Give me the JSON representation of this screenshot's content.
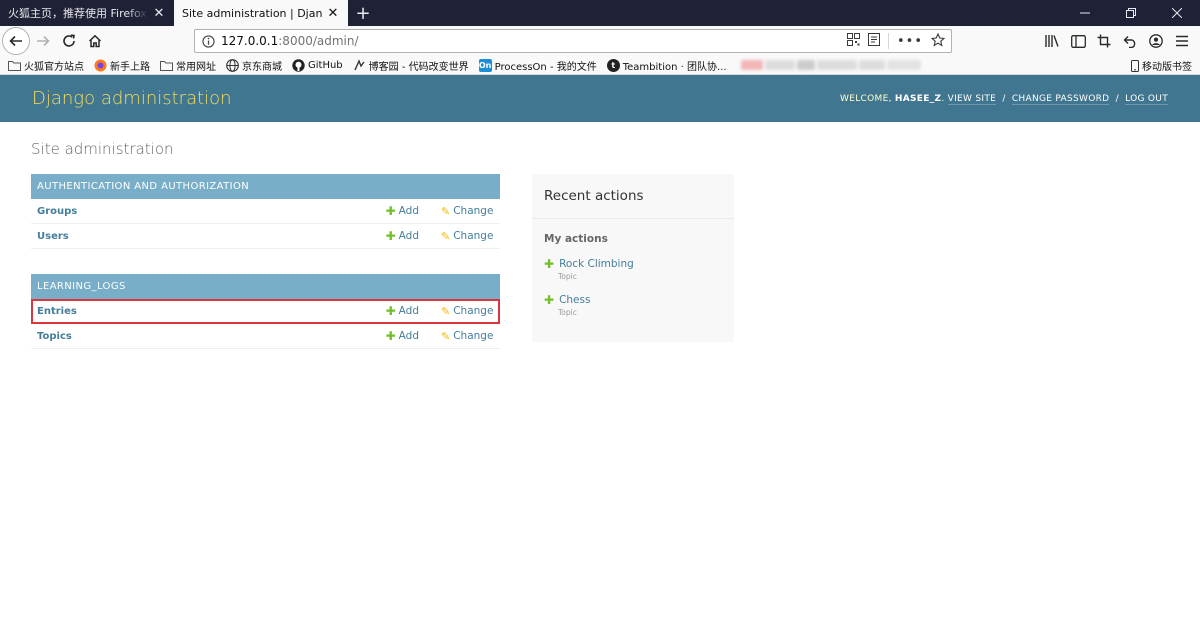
{
  "browser": {
    "tabs": [
      {
        "title": "火狐主页，推荐使用 Firefox 火狐浏",
        "active": false
      },
      {
        "title": "Site administration | Django site",
        "active": true
      }
    ],
    "url": {
      "host": "127.0.0.1",
      "path": ":8000/admin/"
    },
    "bookmarks": [
      {
        "label": "火狐官方站点",
        "icon": "folder-icon"
      },
      {
        "label": "新手上路",
        "icon": "firefox-icon"
      },
      {
        "label": "常用网址",
        "icon": "folder-icon"
      },
      {
        "label": "京东商城",
        "icon": "globe-icon"
      },
      {
        "label": "GitHub",
        "icon": "github-icon"
      },
      {
        "label": "博客园 - 代码改变世界",
        "icon": "cnblogs-icon"
      },
      {
        "label": "ProcessOn - 我的文件",
        "icon": "processon-icon"
      },
      {
        "label": "Teambition · 团队协...",
        "icon": "teambition-icon"
      }
    ],
    "mobile_bookmarks": "移动版书签",
    "colors": {
      "tabbar": "#1f2136",
      "chrome": "#f9f9fa"
    }
  },
  "admin": {
    "branding": "Django administration",
    "user_tools": {
      "welcome": "WELCOME,",
      "username": "HASEE_Z",
      "view_site": "VIEW SITE",
      "change_password": "CHANGE PASSWORD",
      "logout": "LOG OUT",
      "separator": "/"
    },
    "page_title": "Site administration",
    "modules": [
      {
        "caption": "AUTHENTICATION AND AUTHORIZATION",
        "models": [
          {
            "name": "Groups",
            "add": "Add",
            "change": "Change"
          },
          {
            "name": "Users",
            "add": "Add",
            "change": "Change"
          }
        ]
      },
      {
        "caption": "LEARNING_LOGS",
        "models": [
          {
            "name": "Entries",
            "add": "Add",
            "change": "Change",
            "highlighted": true
          },
          {
            "name": "Topics",
            "add": "Add",
            "change": "Change"
          }
        ]
      }
    ],
    "recent_actions": {
      "title": "Recent actions",
      "subtitle": "My actions",
      "items": [
        {
          "name": "Rock Climbing",
          "type": "Topic"
        },
        {
          "name": "Chess",
          "type": "Topic"
        }
      ]
    },
    "colors": {
      "header": "#417690",
      "branding": "#f5dd5d",
      "caption": "#79aec8",
      "link": "#447e9b",
      "add_icon": "#70bf2b",
      "change_icon": "#efb80b",
      "highlight": "#d9363e"
    }
  }
}
